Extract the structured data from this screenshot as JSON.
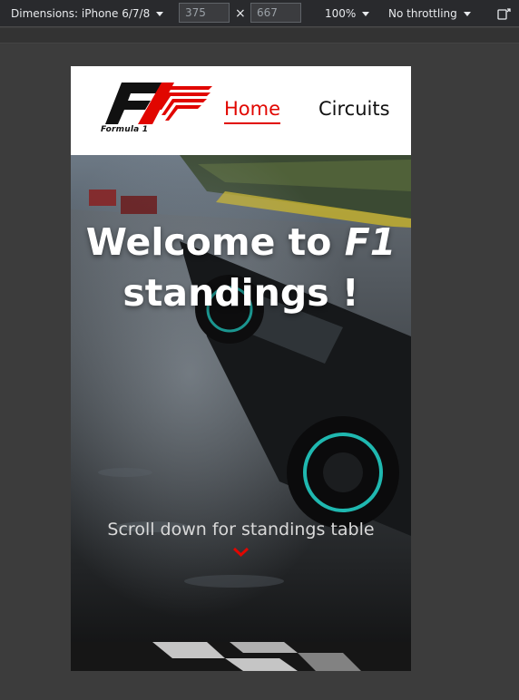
{
  "devtools": {
    "dimensions_label": "Dimensions: iPhone 6/7/8",
    "width_value": "375",
    "height_value": "667",
    "times": "×",
    "zoom_label": "100%",
    "throttling_label": "No throttling",
    "rotate_icon": "rotate-device-icon"
  },
  "site": {
    "logo_text": "Formula 1",
    "nav": {
      "home": "Home",
      "circuits": "Circuits"
    },
    "accent_color": "#e10600"
  },
  "hero": {
    "title_prefix": "Welcome to ",
    "title_f1": "F1",
    "title_suffix": "standings !",
    "scroll_hint": "Scroll down for standings table",
    "chevron_icon": "chevron-down-icon"
  }
}
